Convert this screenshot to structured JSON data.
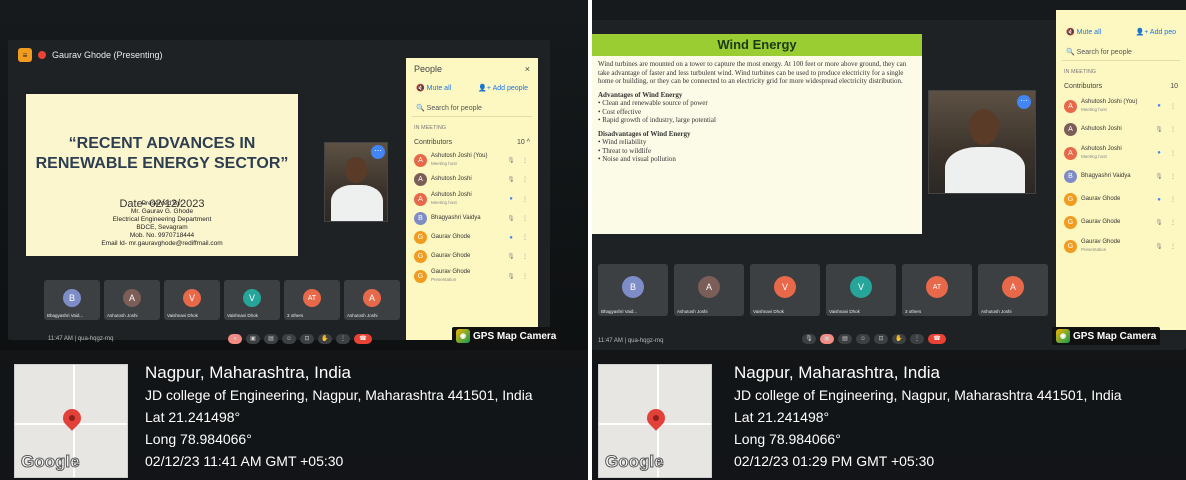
{
  "photo1": {
    "meeting": {
      "presenter_label": "Gaurav Ghode (Presenting)",
      "time_code": "11:47 AM  |  qua-hqgz-rnq"
    },
    "slide": {
      "title_line1": "“RECENT ADVANCES IN",
      "title_line2": "RENEWABLE ENERGY SECTOR”",
      "date": "Date- 02/12/2023",
      "presenter_heading": "Presented By:",
      "presenter_name": "Mr. Gaurav G. Ghode",
      "department": "Electrical Engineering Department",
      "college": "BDCE, Sevagram",
      "mobile": "Mob. No. 9970718444",
      "email": "Email Id- mr.gauravghode@rediffmail.com"
    },
    "people_panel": {
      "title": "People",
      "close": "×",
      "mute_all": "Mute all",
      "add_people": "Add people",
      "search_placeholder": "Search for people",
      "section": "IN MEETING",
      "contributors_label": "Contributors",
      "contributors_count": "10",
      "participants": [
        {
          "initial": "A",
          "name": "Ashutosh Joshi (You)",
          "sub": "Meeting host",
          "color": "#e8684a"
        },
        {
          "initial": "A",
          "name": "Ashutosh Joshi",
          "sub": "",
          "color": "#7b5e57"
        },
        {
          "initial": "A",
          "name": "Ashutosh Joshi",
          "sub": "Meeting host",
          "color": "#e8684a"
        },
        {
          "initial": "B",
          "name": "Bhagyashri Vaidya",
          "sub": "",
          "color": "#7e8cc7"
        },
        {
          "initial": "G",
          "name": "Gaurav Ghode",
          "sub": "",
          "color": "#f29c1f"
        },
        {
          "initial": "G",
          "name": "Gaurav Ghode",
          "sub": "",
          "color": "#f29c1f"
        },
        {
          "initial": "G",
          "name": "Gaurav Ghode",
          "sub": "Presentation",
          "color": "#f29c1f"
        }
      ]
    },
    "tiles": [
      {
        "initial": "B",
        "name": "Bhagyashri Vaid...",
        "color": "#7e8cc7"
      },
      {
        "initial": "A",
        "name": "Ashutosh Joshi",
        "color": "#7b5e57"
      },
      {
        "initial": "V",
        "name": "Vaishnavi Dhok",
        "color": "#e8684a"
      },
      {
        "initial": "V",
        "name": "Vaishnavi Dhok",
        "color": "#26a69a"
      },
      {
        "initial": "AT",
        "name": "3 others",
        "color": "#e8684a"
      },
      {
        "initial": "A",
        "name": "Ashutosh Joshi",
        "color": "#e8684a"
      }
    ],
    "gps": {
      "badge": "GPS Map Camera",
      "place": "Nagpur, Maharashtra, India",
      "address": "JD college of Engineering, Nagpur, Maharashtra 441501, India",
      "lat": "Lat 21.241498°",
      "long": "Long 78.984066°",
      "datetime": "02/12/23 11:41 AM GMT +05:30",
      "map_logo": "Google"
    }
  },
  "photo2": {
    "meeting": {
      "time_code": "11:47 AM  |  qua-hqgz-rnq"
    },
    "slide": {
      "title": "Wind Energy",
      "para": "Wind turbines are mounted on a tower to capture the most energy. At 100 feet or more above ground, they can take advantage of faster and less turbulent wind. Wind turbines can be used to produce electricity for a single home or building, or they can be connected to an electricity grid for more widespread electricity distribution.",
      "adv_heading": "Advantages of Wind Energy",
      "adv_items": [
        "Clean and renewable source of power",
        "Cost effective",
        "Rapid growth of industry, large potential"
      ],
      "dis_heading": "Disadvantages of Wind Energy",
      "dis_items": [
        "Wind reliability",
        "Threat to wildlife",
        "Noise and visual pollution"
      ]
    },
    "people_panel": {
      "mute_all": "Mute all",
      "add_people": "Add peo",
      "search_placeholder": "Search for people",
      "section": "IN MEETING",
      "contributors_label": "Contributors",
      "contributors_count": "10",
      "participants": [
        {
          "initial": "A",
          "name": "Ashutosh Joshi (You)",
          "sub": "Meeting host",
          "color": "#e8684a"
        },
        {
          "initial": "A",
          "name": "Ashutosh Joshi",
          "sub": "",
          "color": "#7b5e57"
        },
        {
          "initial": "A",
          "name": "Ashutosh Joshi",
          "sub": "Meeting host",
          "color": "#e8684a"
        },
        {
          "initial": "B",
          "name": "Bhagyashri Vaidya",
          "sub": "",
          "color": "#7e8cc7"
        },
        {
          "initial": "G",
          "name": "Gaurav Ghode",
          "sub": "",
          "color": "#f29c1f"
        },
        {
          "initial": "G",
          "name": "Gaurav Ghode",
          "sub": "",
          "color": "#f29c1f"
        },
        {
          "initial": "G",
          "name": "Gaurav Ghode",
          "sub": "Presentation",
          "color": "#f29c1f"
        }
      ]
    },
    "tiles": [
      {
        "initial": "B",
        "name": "Bhagyashri Vaid...",
        "color": "#7e8cc7"
      },
      {
        "initial": "A",
        "name": "Ashutosh Joshi",
        "color": "#7b5e57"
      },
      {
        "initial": "V",
        "name": "Vaishnavi Dhok",
        "color": "#e8684a"
      },
      {
        "initial": "V",
        "name": "Vaishnavi Dhok",
        "color": "#26a69a"
      },
      {
        "initial": "AT",
        "name": "3 others",
        "color": "#e8684a"
      },
      {
        "initial": "A",
        "name": "Ashutosh Joshi",
        "color": "#e8684a"
      }
    ],
    "gps": {
      "badge": "GPS Map Camera",
      "place": "Nagpur, Maharashtra, India",
      "address": "JD college of Engineering, Nagpur, Maharashtra 441501, India",
      "lat": "Lat 21.241498°",
      "long": "Long 78.984066°",
      "datetime": "02/12/23 01:29 PM GMT +05:30",
      "map_logo": "Google"
    }
  }
}
